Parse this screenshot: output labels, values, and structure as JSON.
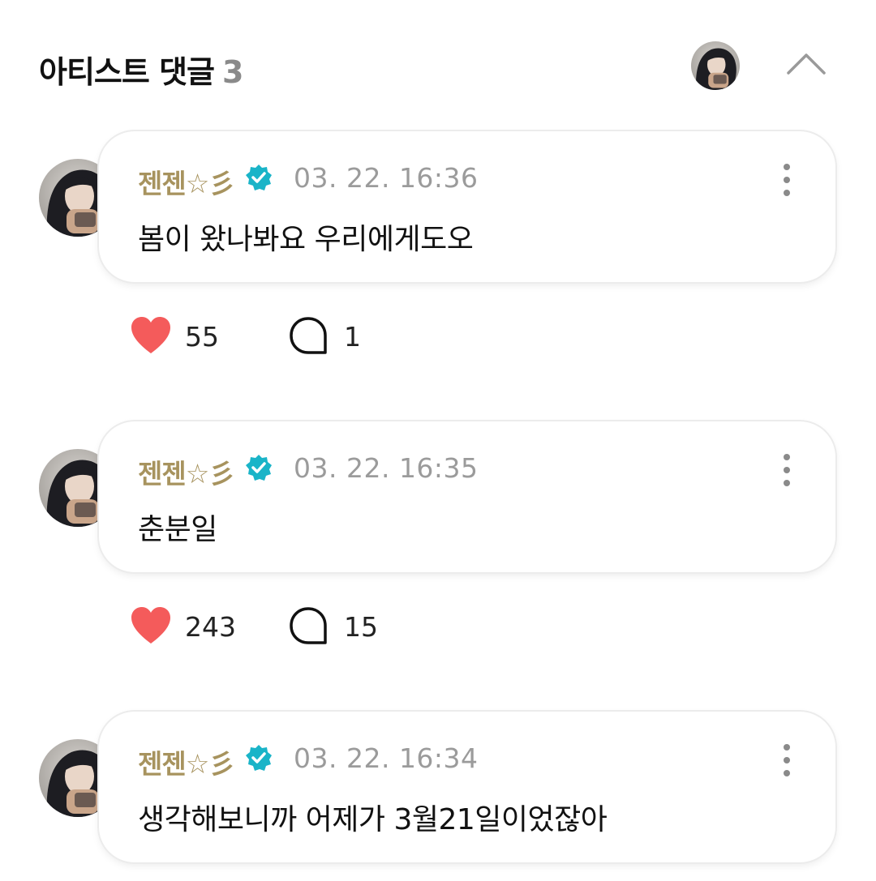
{
  "header": {
    "title": "아티스트 댓글",
    "count": "3",
    "collapse_icon": "chevron-up-icon"
  },
  "comments": [
    {
      "author": "젠젠☆彡",
      "time": "03. 22. 16:36",
      "text": "봄이 왔나봐요 우리에게도오",
      "likes": "55",
      "replies": "1"
    },
    {
      "author": "젠젠☆彡",
      "time": "03. 22. 16:35",
      "text": "춘분일",
      "likes": "243",
      "replies": "15"
    },
    {
      "author": "젠젠☆彡",
      "time": "03. 22. 16:34",
      "text": "생각해보니까 어제가 3월21일이었잖아",
      "likes": "",
      "replies": ""
    }
  ],
  "colors": {
    "author": "#a7935e",
    "verified": "#1ab4c8",
    "heart": "#f45b5b",
    "count_gray": "#8a8a8a"
  },
  "icons": [
    "verified-badge-icon",
    "more-vertical-icon",
    "heart-icon",
    "speech-bubble-icon",
    "chevron-up-icon"
  ]
}
